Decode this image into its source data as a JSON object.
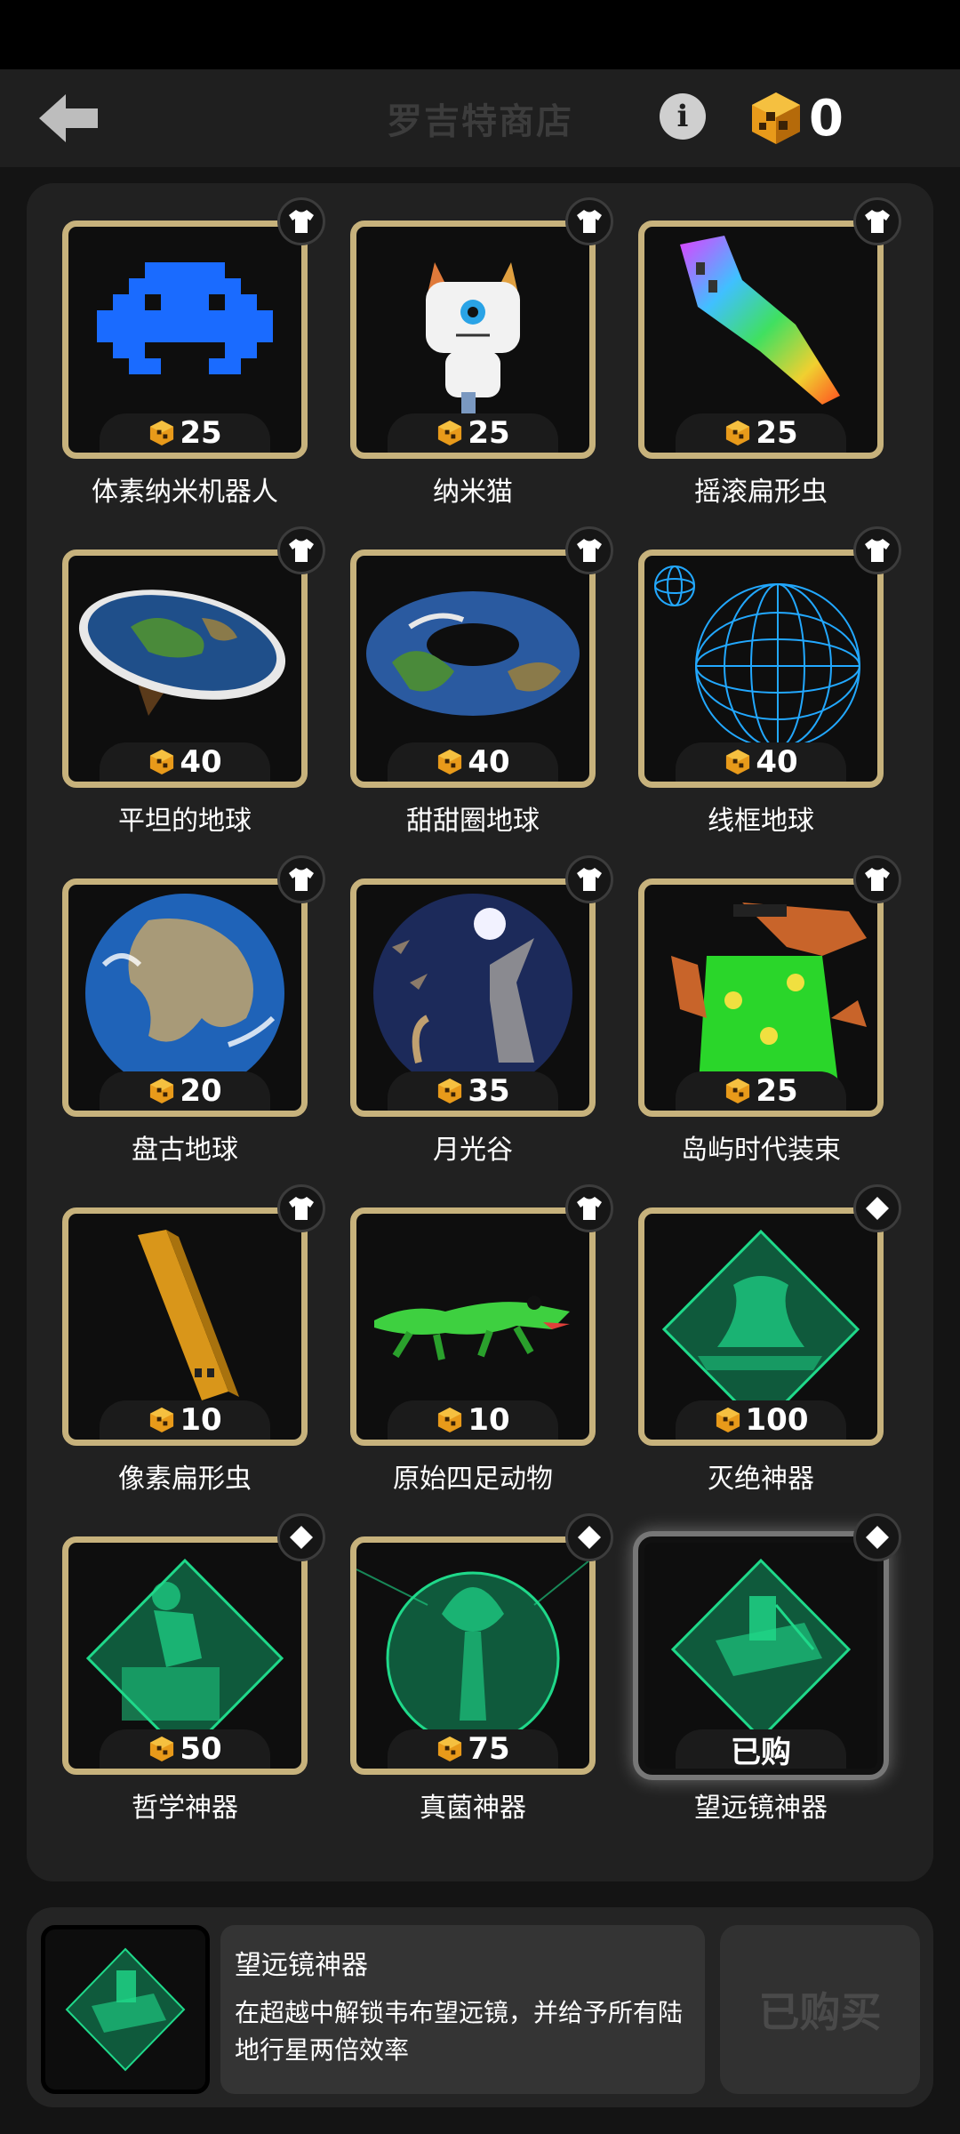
{
  "header": {
    "title": "罗吉特商店",
    "currency_amount": "0"
  },
  "items": [
    {
      "name": "体素纳米机器人",
      "price": "25",
      "badge": "shirt-icon"
    },
    {
      "name": "纳米猫",
      "price": "25",
      "badge": "shirt-icon"
    },
    {
      "name": "摇滚扁形虫",
      "price": "25",
      "badge": "shirt-icon"
    },
    {
      "name": "平坦的地球",
      "price": "40",
      "badge": "shirt-icon"
    },
    {
      "name": "甜甜圈地球",
      "price": "40",
      "badge": "shirt-icon"
    },
    {
      "name": "线框地球",
      "price": "40",
      "badge": "shirt-icon"
    },
    {
      "name": "盘古地球",
      "price": "20",
      "badge": "shirt-icon"
    },
    {
      "name": "月光谷",
      "price": "35",
      "badge": "shirt-icon"
    },
    {
      "name": "岛屿时代装束",
      "price": "25",
      "badge": "shirt-icon"
    },
    {
      "name": "像素扁形虫",
      "price": "10",
      "badge": "shirt-icon"
    },
    {
      "name": "原始四足动物",
      "price": "10",
      "badge": "shirt-icon"
    },
    {
      "name": "灭绝神器",
      "price": "100",
      "badge": "diamond-icon"
    },
    {
      "name": "哲学神器",
      "price": "50",
      "badge": "diamond-icon"
    },
    {
      "name": "真菌神器",
      "price": "75",
      "badge": "diamond-icon"
    },
    {
      "name": "望远镜神器",
      "price": "已购",
      "badge": "diamond-icon"
    }
  ],
  "selected": {
    "name": "望远镜神器",
    "description": "在超越中解锁韦布望远镜，并给予所有陆地行星两倍效率",
    "button_label": "已购买"
  },
  "colors": {
    "card_border": "#c7b27c",
    "artifact_green": "#1fd98a",
    "background": "#141414"
  }
}
